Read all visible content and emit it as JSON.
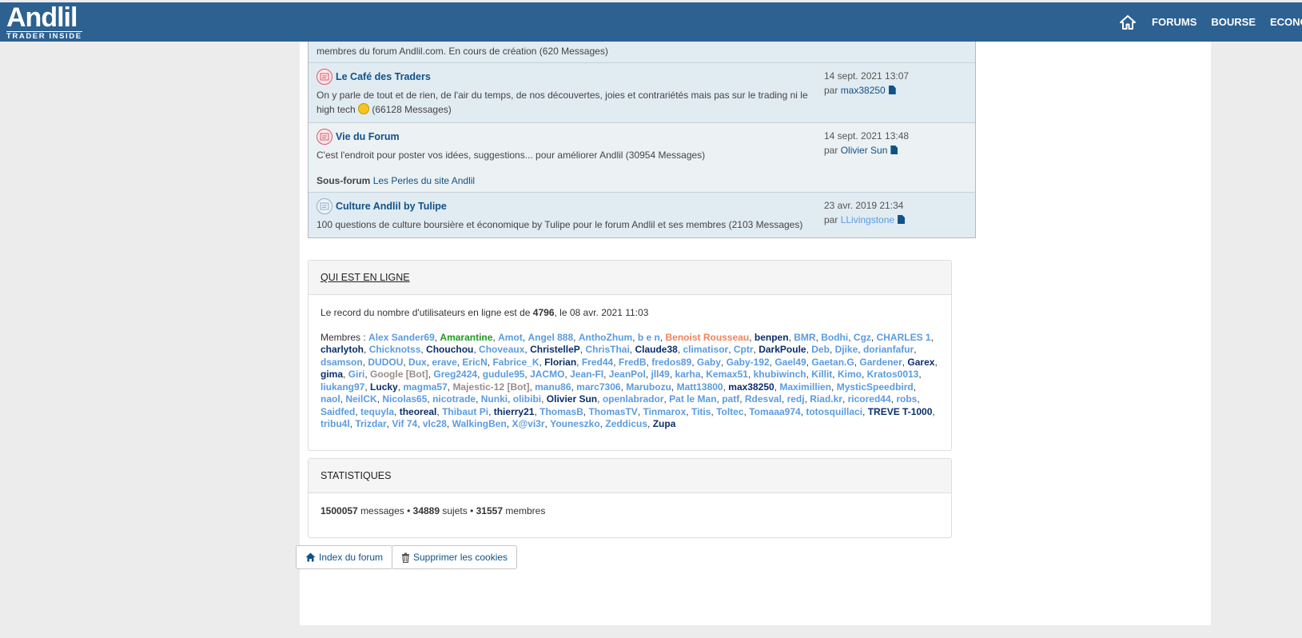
{
  "header": {
    "logo_text": "Andlil",
    "logo_tagline": "TRADER INSIDE",
    "nav": [
      "FORUMS",
      "BOURSE",
      "ECONO"
    ]
  },
  "forums": {
    "top_fragment": "membres du forum Andlil.com. En cours de création (620 Messages)",
    "rows": [
      {
        "title": "Le Café des Traders",
        "desc_before": "On y parle de tout et de rien, de l'air du temps, de nos découvertes, joies et contrariétés mais pas sur le trading ni le high tech",
        "desc_after": "(66128 Messages)",
        "date": "14 sept. 2021 13:07",
        "by": "par",
        "author": "max38250"
      },
      {
        "title": "Vie du Forum",
        "desc": "C'est l'endroit pour poster vos idées, suggestions... pour améliorer Andlil (30954 Messages)",
        "subforum_label": "Sous-forum",
        "subforum": "Les Perles du site Andlil",
        "date": "14 sept. 2021 13:48",
        "by": "par",
        "author": "Olivier Sun"
      },
      {
        "title": "Culture Andlil by Tulipe",
        "desc": "100 questions de culture boursière et économique by Tulipe pour le forum Andlil et ses membres (2103 Messages)",
        "date": "23 avr. 2019 21:34",
        "by": "par",
        "author": "LLivingstone"
      }
    ]
  },
  "online": {
    "title": "QUI EST EN LIGNE",
    "record_prefix": "Le record du nombre d'utilisateurs en ligne est de",
    "record_count": "4796",
    "record_suffix": ", le 08 avr. 2021 11:03",
    "members_label": "Membres :",
    "members": [
      {
        "n": "Alex Sander69",
        "c": "light"
      },
      {
        "n": "Amarantine",
        "c": "green"
      },
      {
        "n": "Amot",
        "c": "light"
      },
      {
        "n": "Angel 888",
        "c": "light"
      },
      {
        "n": "AnthoZhum",
        "c": "light"
      },
      {
        "n": "b e n",
        "c": "light"
      },
      {
        "n": "Benoist Rousseau",
        "c": "orange"
      },
      {
        "n": "benpen",
        "c": "dark"
      },
      {
        "n": "BMR",
        "c": "light"
      },
      {
        "n": "Bodhi",
        "c": "light"
      },
      {
        "n": "Cgz",
        "c": "light"
      },
      {
        "n": "CHARLES 1",
        "c": "light"
      },
      {
        "n": "charlytoh",
        "c": "dark"
      },
      {
        "n": "Chicknotss",
        "c": "light"
      },
      {
        "n": "Chouchou",
        "c": "dark"
      },
      {
        "n": "Choveaux",
        "c": "light"
      },
      {
        "n": "ChristelleP",
        "c": "dark"
      },
      {
        "n": "ChrisThai",
        "c": "light"
      },
      {
        "n": "Claude38",
        "c": "dark"
      },
      {
        "n": "climatisor",
        "c": "light"
      },
      {
        "n": "Cptr",
        "c": "light"
      },
      {
        "n": "DarkPoule",
        "c": "dark"
      },
      {
        "n": "Deb",
        "c": "light"
      },
      {
        "n": "Djike",
        "c": "light"
      },
      {
        "n": "dorianfafur",
        "c": "light"
      },
      {
        "n": "dsamson",
        "c": "light"
      },
      {
        "n": "DUDOU",
        "c": "light"
      },
      {
        "n": "Dux",
        "c": "light"
      },
      {
        "n": "erave",
        "c": "light"
      },
      {
        "n": "EricN",
        "c": "light"
      },
      {
        "n": "Fabrice_K",
        "c": "light"
      },
      {
        "n": "Florian",
        "c": "dark"
      },
      {
        "n": "Fred44",
        "c": "light"
      },
      {
        "n": "FredB",
        "c": "light"
      },
      {
        "n": "fredos89",
        "c": "light"
      },
      {
        "n": "Gaby",
        "c": "light"
      },
      {
        "n": "Gaby-192",
        "c": "light"
      },
      {
        "n": "Gael49",
        "c": "light"
      },
      {
        "n": "Gaetan.G",
        "c": "light"
      },
      {
        "n": "Gardener",
        "c": "light"
      },
      {
        "n": "Garex",
        "c": "dark"
      },
      {
        "n": "gima",
        "c": "dark"
      },
      {
        "n": "Giri",
        "c": "light"
      },
      {
        "n": "Google [Bot]",
        "c": "bot"
      },
      {
        "n": "Greg2424",
        "c": "light"
      },
      {
        "n": "gudule95",
        "c": "light"
      },
      {
        "n": "JACMO",
        "c": "light"
      },
      {
        "n": "Jean-Fl",
        "c": "light"
      },
      {
        "n": "JeanPol",
        "c": "light"
      },
      {
        "n": "jll49",
        "c": "light"
      },
      {
        "n": "karha",
        "c": "light"
      },
      {
        "n": "Kemax51",
        "c": "light"
      },
      {
        "n": "khubiwinch",
        "c": "light"
      },
      {
        "n": "Killit",
        "c": "light"
      },
      {
        "n": "Kimo",
        "c": "light"
      },
      {
        "n": "Kratos0013",
        "c": "light"
      },
      {
        "n": "liukang97",
        "c": "light"
      },
      {
        "n": "Lucky",
        "c": "dark"
      },
      {
        "n": "magma57",
        "c": "light"
      },
      {
        "n": "Majestic-12 [Bot]",
        "c": "bot"
      },
      {
        "n": "manu86",
        "c": "light"
      },
      {
        "n": "marc7306",
        "c": "light"
      },
      {
        "n": "Marubozu",
        "c": "light"
      },
      {
        "n": "Matt13800",
        "c": "light"
      },
      {
        "n": "max38250",
        "c": "dark"
      },
      {
        "n": "Maximillien",
        "c": "light"
      },
      {
        "n": "MysticSpeedbird",
        "c": "light"
      },
      {
        "n": "naol",
        "c": "light"
      },
      {
        "n": "NeilCK",
        "c": "light"
      },
      {
        "n": "Nicolas65",
        "c": "light"
      },
      {
        "n": "nicotrade",
        "c": "light"
      },
      {
        "n": "Nunki",
        "c": "light"
      },
      {
        "n": "olibibi",
        "c": "light"
      },
      {
        "n": "Olivier Sun",
        "c": "dark"
      },
      {
        "n": "openlabrador",
        "c": "light"
      },
      {
        "n": "Pat le Man",
        "c": "light"
      },
      {
        "n": "patf",
        "c": "light"
      },
      {
        "n": "Rdesval",
        "c": "light"
      },
      {
        "n": "redj",
        "c": "light"
      },
      {
        "n": "Riad.kr",
        "c": "light"
      },
      {
        "n": "ricored44",
        "c": "light"
      },
      {
        "n": "robs",
        "c": "light"
      },
      {
        "n": "Saidfed",
        "c": "light"
      },
      {
        "n": "tequyla",
        "c": "light"
      },
      {
        "n": "theoreal",
        "c": "dark"
      },
      {
        "n": "Thibaut Pi",
        "c": "light"
      },
      {
        "n": "thierry21",
        "c": "dark"
      },
      {
        "n": "ThomasB",
        "c": "light"
      },
      {
        "n": "ThomasTV",
        "c": "light"
      },
      {
        "n": "Tinmarox",
        "c": "light"
      },
      {
        "n": "Titis",
        "c": "light"
      },
      {
        "n": "Toltec",
        "c": "light"
      },
      {
        "n": "Tomaaa974",
        "c": "light"
      },
      {
        "n": "totosquillaci",
        "c": "light"
      },
      {
        "n": "TREVE T-1000",
        "c": "dark"
      },
      {
        "n": "tribu4l",
        "c": "light"
      },
      {
        "n": "Trizdar",
        "c": "light"
      },
      {
        "n": "Vif 74",
        "c": "light"
      },
      {
        "n": "vlc28",
        "c": "light"
      },
      {
        "n": "WalkingBen",
        "c": "light"
      },
      {
        "n": "X@vi3r",
        "c": "light"
      },
      {
        "n": "Youneszko",
        "c": "light"
      },
      {
        "n": "Zeddicus",
        "c": "light"
      },
      {
        "n": "Zupa",
        "c": "dark"
      }
    ]
  },
  "stats": {
    "title": "STATISTIQUES",
    "messages_count": "1500057",
    "messages_label": "messages",
    "subjects_count": "34889",
    "subjects_label": "sujets",
    "members_count": "31557",
    "members_label": "membres",
    "separator": "•"
  },
  "buttons": {
    "index": "Index du forum",
    "cookies": "Supprimer les cookies"
  },
  "colors": {
    "header_bg": "#2c6192",
    "link_dark": "#0a2f6b",
    "link_light": "#5a9be0",
    "member_green": "#1e9a1e",
    "member_orange": "#f2835a",
    "bot": "#9b8b8b"
  }
}
